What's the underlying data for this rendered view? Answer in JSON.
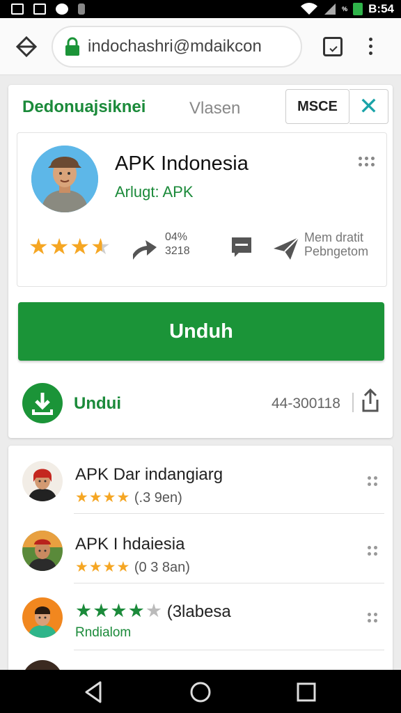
{
  "status_bar": {
    "time": "B:54",
    "signal_label": "%"
  },
  "browser": {
    "url": "indochashri@mdaikcon"
  },
  "card": {
    "header_title": "Dedonuajsiknei",
    "header_tab": "Vlasen",
    "msce_label": "MSCE",
    "close_glyph": "✕",
    "app": {
      "title": "APK Indonesia",
      "subtitle": "Arlugt: APK",
      "rating": 3.5,
      "stat_line1": "04%",
      "stat_line2": "3218",
      "label_line1": "Mem dratit",
      "label_line2": "Pebngetom"
    },
    "download_button": "Unduh",
    "footer": {
      "label": "Undui",
      "count": "44-300118"
    }
  },
  "related": [
    {
      "title": "APK Dar indangiarg",
      "stars": "★★★★",
      "rating_text": "(.3 9en)"
    },
    {
      "title": "APK I hdaiesia",
      "stars": "★★★★",
      "rating_text": "(0 3 8an)"
    },
    {
      "stars": "★★★★",
      "rating_text": "(3labesa",
      "subtitle": "Rndialom"
    }
  ],
  "colors": {
    "accent_green": "#1b9438",
    "header_green": "#1b8a3a",
    "star_orange": "#f5a623",
    "close_teal": "#1aa3a8"
  }
}
